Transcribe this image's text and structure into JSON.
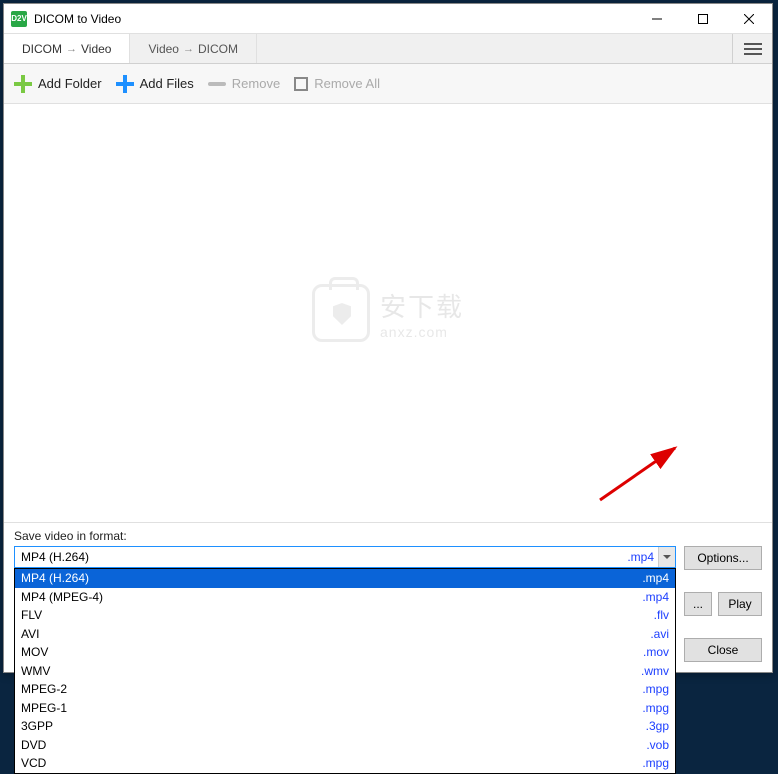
{
  "window": {
    "title": "DICOM to Video",
    "app_icon_text": "D2V"
  },
  "tabs": [
    {
      "from": "DICOM",
      "to": "Video",
      "active": true
    },
    {
      "from": "Video",
      "to": "DICOM",
      "active": false
    }
  ],
  "toolbar": {
    "add_folder": "Add Folder",
    "add_files": "Add Files",
    "remove": "Remove",
    "remove_all": "Remove All"
  },
  "watermark": {
    "line1": "安下载",
    "line2": "anxz.com"
  },
  "format": {
    "label": "Save video in format:",
    "selected_name": "MP4 (H.264)",
    "selected_ext": ".mp4",
    "options": [
      {
        "name": "MP4 (H.264)",
        "ext": ".mp4",
        "selected": true
      },
      {
        "name": "MP4 (MPEG-4)",
        "ext": ".mp4"
      },
      {
        "name": "FLV",
        "ext": ".flv"
      },
      {
        "name": "AVI",
        "ext": ".avi"
      },
      {
        "name": "MOV",
        "ext": ".mov"
      },
      {
        "name": "WMV",
        "ext": ".wmv"
      },
      {
        "name": "MPEG-2",
        "ext": ".mpg"
      },
      {
        "name": "MPEG-1",
        "ext": ".mpg"
      },
      {
        "name": "3GPP",
        "ext": ".3gp"
      },
      {
        "name": "DVD",
        "ext": ".vob"
      },
      {
        "name": "VCD",
        "ext": ".mpg"
      }
    ]
  },
  "buttons": {
    "options": "Options...",
    "browse": "...",
    "play": "Play",
    "close": "Close"
  }
}
